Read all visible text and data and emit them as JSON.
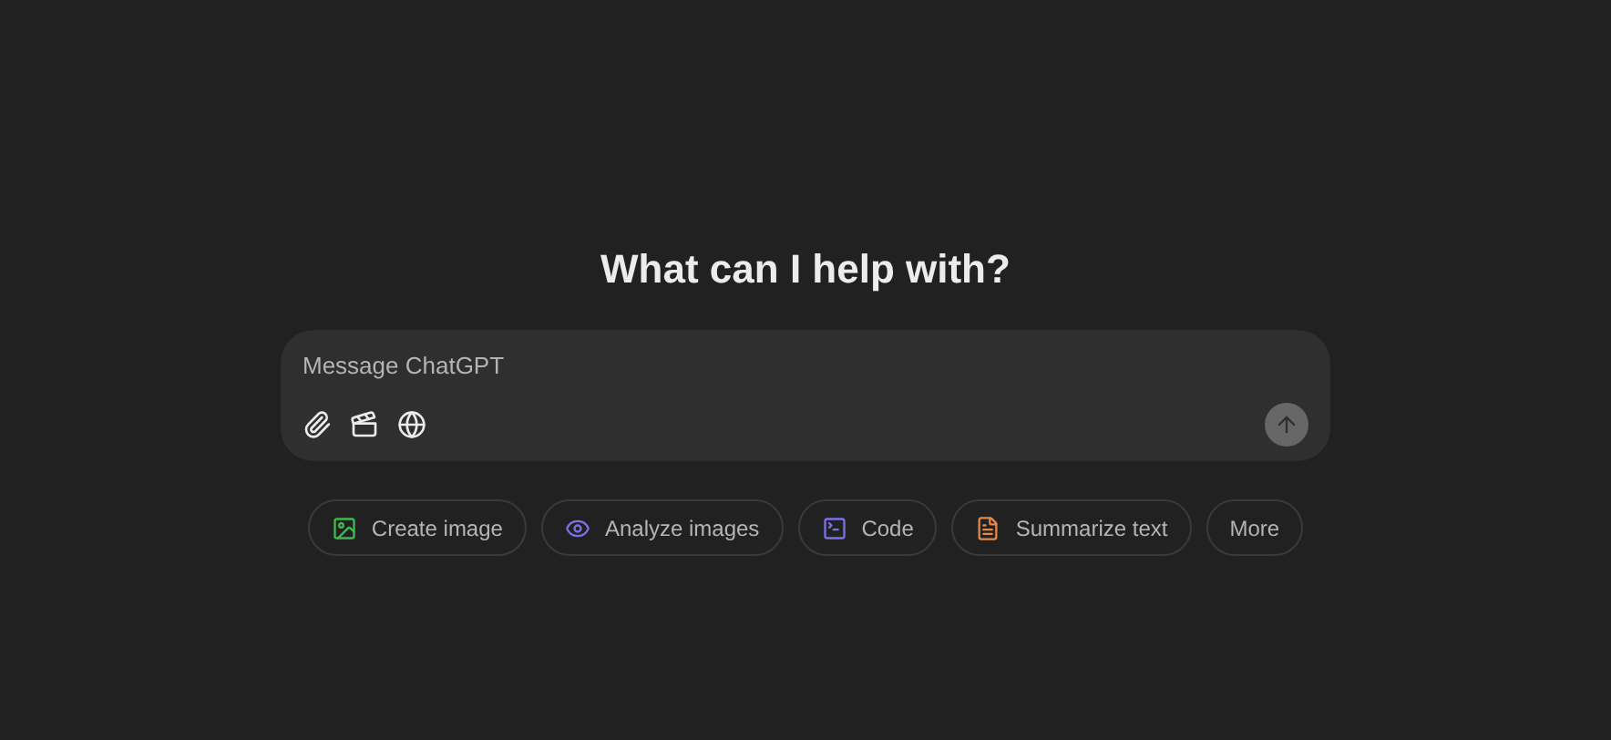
{
  "heading": "What can I help with?",
  "composer": {
    "placeholder": "Message ChatGPT",
    "send_disabled": true
  },
  "chips": [
    {
      "label": "Create image",
      "kind": "image",
      "color": "#3fb950"
    },
    {
      "label": "Analyze images",
      "kind": "eye",
      "color": "#7b72e9"
    },
    {
      "label": "Code",
      "kind": "code",
      "color": "#7b72e9"
    },
    {
      "label": "Summarize text",
      "kind": "doc",
      "color": "#e2884b"
    },
    {
      "label": "More",
      "kind": "none"
    }
  ]
}
